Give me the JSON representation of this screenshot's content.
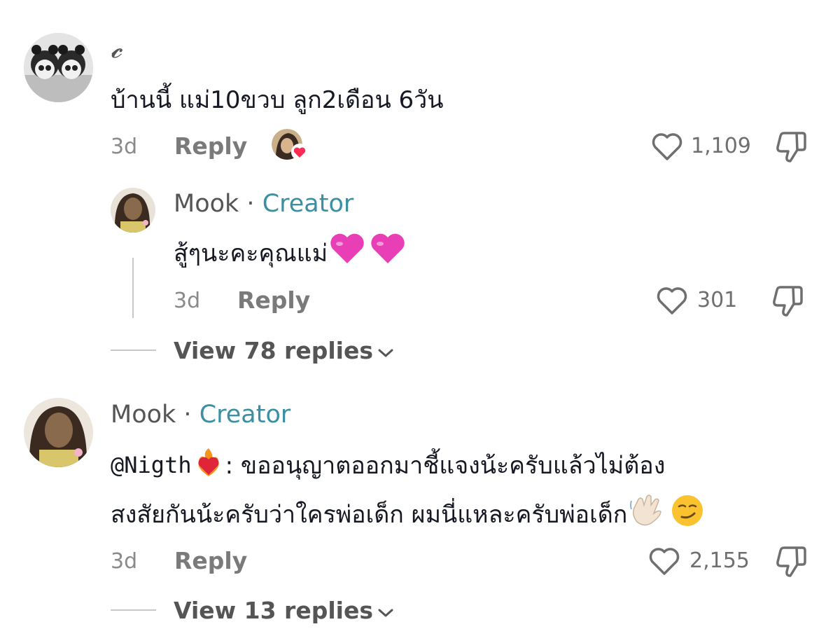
{
  "comments": [
    {
      "username": "𝓬",
      "text": "บ้านนี้ แม่10ขวบ ลูก2เดือน 6วัน",
      "time": "3d",
      "reply_label": "Reply",
      "likes": "1,109",
      "reply": {
        "username": "Mook",
        "separator": " · ",
        "creator_label": "Creator",
        "text": "สู้ๆนะคะคุณแม่",
        "time": "3d",
        "reply_label": "Reply",
        "likes": "301"
      },
      "view_replies": "View 78 replies"
    },
    {
      "username": "Mook",
      "separator": " · ",
      "creator_label": "Creator",
      "mention": "@Nigth",
      "text_line1": ": ขออนุญาตออกมาชี้แจงน้ะครับแล้วไม่ต้อง",
      "text_line2": "สงสัยกันน้ะครับว่าใครพ่อเด็ก ผมนี่แหละครับพ่อเด็ก",
      "time": "3d",
      "reply_label": "Reply",
      "likes": "2,155",
      "view_replies": "View 13 replies"
    }
  ]
}
